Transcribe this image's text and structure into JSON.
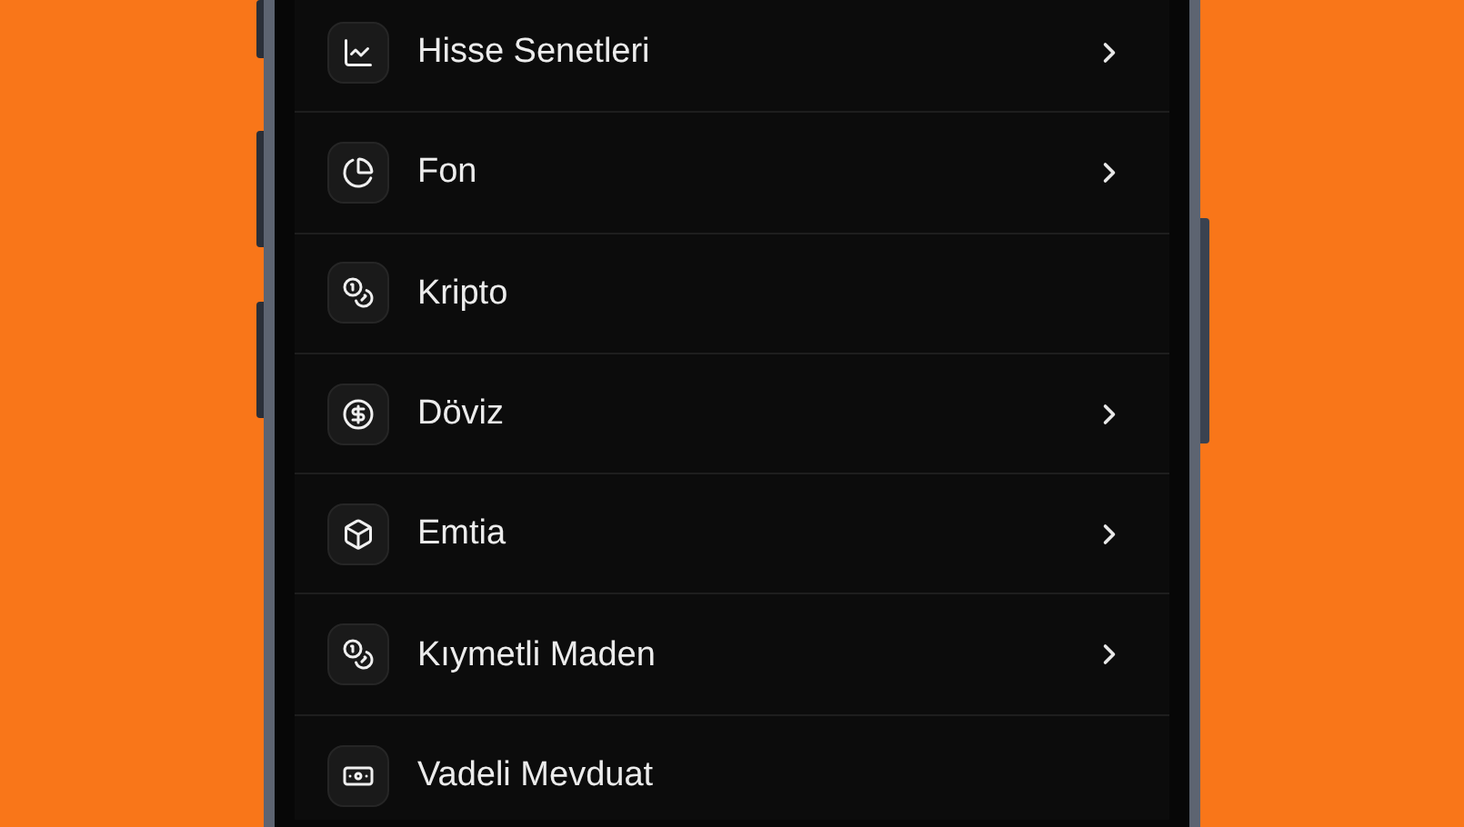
{
  "menu": {
    "items": [
      {
        "label": "Hisse Senetleri",
        "chevron": true
      },
      {
        "label": "Fon",
        "chevron": true
      },
      {
        "label": "Kripto",
        "chevron": false
      },
      {
        "label": "Döviz",
        "chevron": true
      },
      {
        "label": "Emtia",
        "chevron": true
      },
      {
        "label": "Kıymetli Maden",
        "chevron": true
      },
      {
        "label": "Vadeli Mevduat",
        "chevron": false
      }
    ]
  }
}
